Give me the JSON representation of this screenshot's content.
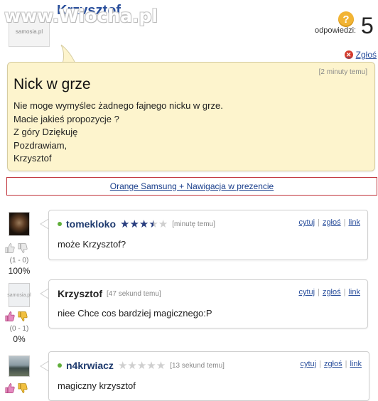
{
  "watermark": "www.Wiocha.pl",
  "question": {
    "author": "Krzysztof",
    "avatar_text": "samosia.pl",
    "answers_label": "odpowiedzi:",
    "answers_count": "5",
    "report_label": "Zgłoś",
    "time": "[2 minuty temu]",
    "title": "Nick w grze",
    "body": [
      "Nie moge wymyślec żadnego fajnego nicku w grze.",
      "Macie jakieś propozycje ?",
      "Z góry Dziękuję",
      "Pozdrawiam,",
      "Krzysztof"
    ]
  },
  "banner": {
    "label": "Orange Samsung + Nawigacja w prezencie"
  },
  "answers": [
    {
      "author": "tomekloko",
      "online": true,
      "rating": 3.5,
      "time": "[minutę temu]",
      "text": "może Krzysztof?",
      "vote_ratio": "(1 - 0)",
      "vote_pct": "100%",
      "actions": [
        "cytuj",
        "zgłoś",
        "link"
      ]
    },
    {
      "author": "Krzysztof",
      "online": false,
      "avatar_text": "samosia.pl",
      "time": "[47 sekund temu]",
      "text": "niee Chce cos bardziej magicznego:P",
      "vote_ratio": "(0 - 1)",
      "vote_pct": "0%",
      "actions": [
        "cytuj",
        "zgłoś",
        "link"
      ]
    },
    {
      "author": "n4krwiacz",
      "online": true,
      "rating": 0,
      "time": "[13 sekund temu]",
      "text": "magiczny krzysztof",
      "actions": [
        "cytuj",
        "zgłoś",
        "link"
      ]
    }
  ],
  "colors": {
    "link": "#2a4f9c",
    "bubble": "#fdf4cd",
    "banner_border": "#c0323a",
    "star": "#2a3f80"
  }
}
